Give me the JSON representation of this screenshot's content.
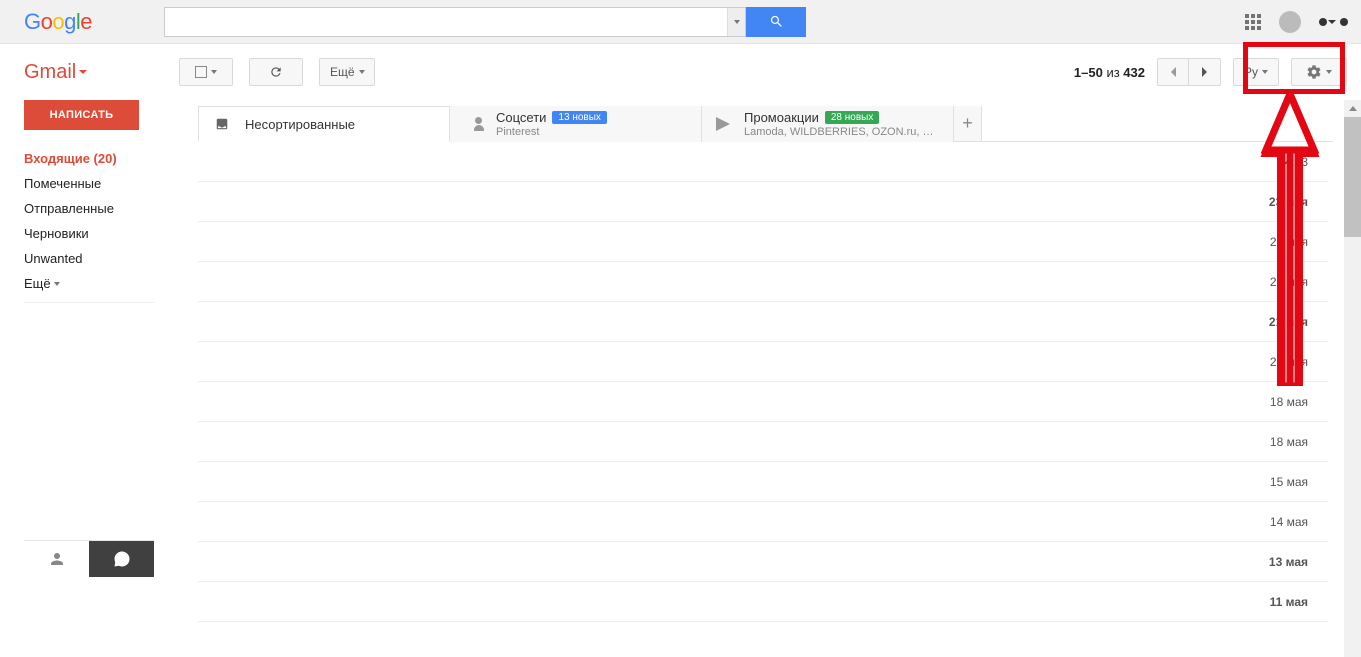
{
  "header": {
    "logo": [
      "G",
      "o",
      "o",
      "g",
      "l",
      "e"
    ],
    "search_placeholder": ""
  },
  "toolbar": {
    "gmail": "Gmail",
    "more": "Ещё",
    "count_range": "1–50",
    "count_of": "из",
    "count_total": "432",
    "lang": "Ру"
  },
  "sidebar": {
    "compose": "НАПИСАТЬ",
    "items": [
      {
        "label": "Входящие (20)",
        "active": true
      },
      {
        "label": "Помеченные"
      },
      {
        "label": "Отправленные"
      },
      {
        "label": "Черновики"
      },
      {
        "label": "Unwanted"
      }
    ],
    "more": "Ещё"
  },
  "tabs": [
    {
      "label": "Несортированные",
      "active": true,
      "icon": "inbox"
    },
    {
      "label": "Соцсети",
      "badge": "13 новых",
      "badge_color": "blue",
      "sub": "Pinterest",
      "icon": "people"
    },
    {
      "label": "Промоакции",
      "badge": "28 новых",
      "badge_color": "green",
      "sub": "Lamoda, WILDBERRIES, OZON.ru, La...",
      "icon": "tag"
    }
  ],
  "mails": [
    {
      "date": "4:03"
    },
    {
      "date": "23 мая",
      "bold": true
    },
    {
      "date": "23 мая"
    },
    {
      "date": "22 мая"
    },
    {
      "date": "21 мая",
      "bold": true
    },
    {
      "date": "21 мая"
    },
    {
      "date": "18 мая"
    },
    {
      "date": "18 мая"
    },
    {
      "date": "15 мая"
    },
    {
      "date": "14 мая"
    },
    {
      "date": "13 мая",
      "bold": true
    },
    {
      "date": "11 мая",
      "bold": true
    }
  ]
}
